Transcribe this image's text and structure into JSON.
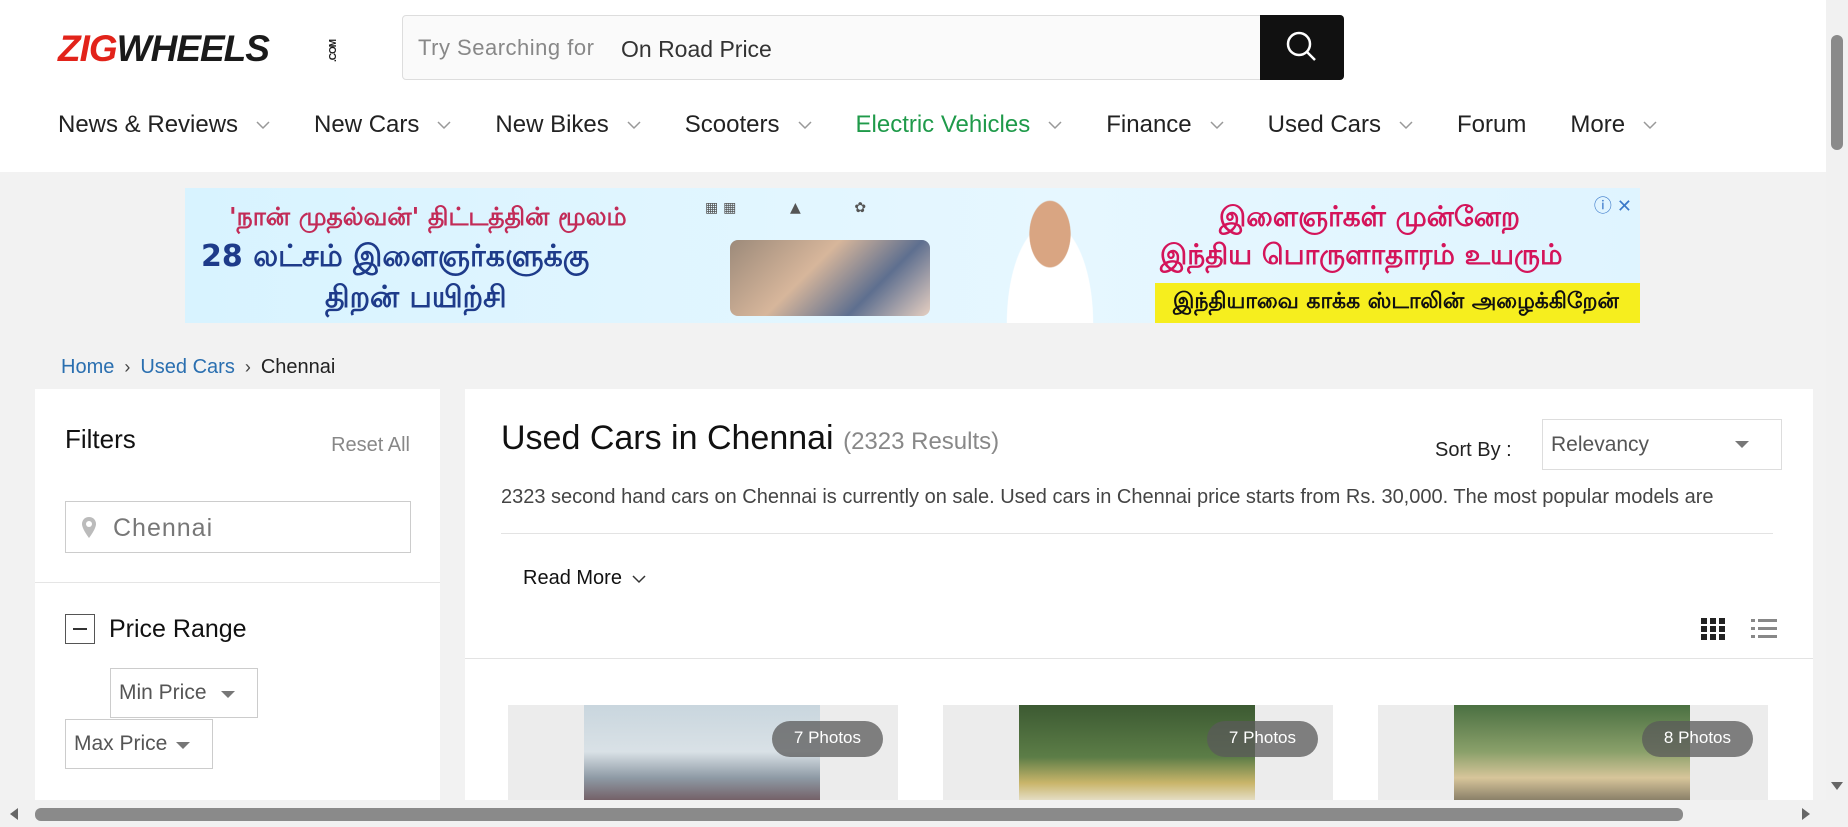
{
  "header": {
    "logo": {
      "part1": "ZIG",
      "part2": "WHEELS",
      "suffix": ".COM"
    },
    "search": {
      "placeholder": "Try Searching for",
      "value": "On Road Price"
    },
    "nav": [
      {
        "label": "News & Reviews",
        "has_menu": true
      },
      {
        "label": "New Cars",
        "has_menu": true
      },
      {
        "label": "New Bikes",
        "has_menu": true
      },
      {
        "label": "Scooters",
        "has_menu": true
      },
      {
        "label": "Electric Vehicles",
        "has_menu": true,
        "highlight": "#1f9a4a"
      },
      {
        "label": "Finance",
        "has_menu": true
      },
      {
        "label": "Used Cars",
        "has_menu": true
      },
      {
        "label": "Forum",
        "has_menu": false
      },
      {
        "label": "More",
        "has_menu": true
      }
    ]
  },
  "ad": {
    "line1": "'நான் முதல்வன்' திட்டத்தின் மூலம்",
    "line2": "28 லட்சம் இளைஞர்களுக்கு",
    "line3": "திறன் பயிற்சி",
    "right1": "இளைஞர்கள் முன்னேற",
    "right2": "இந்திய பொருளாதாரம் உயரும்",
    "right3": "இந்தியாவை காக்க ஸ்டாலின் அழைக்கிறேன்"
  },
  "breadcrumb": {
    "home": "Home",
    "section": "Used Cars",
    "current": "Chennai"
  },
  "filters": {
    "title": "Filters",
    "reset": "Reset All",
    "city": "Chennai",
    "price_range": {
      "label": "Price Range",
      "min": "Min Price",
      "max": "Max Price"
    }
  },
  "main": {
    "title": "Used Cars in Chennai",
    "count": "(2323 Results)",
    "sort_label": "Sort By :",
    "sort_value": "Relevancy",
    "description": "2323 second hand cars on Chennai is currently on sale. Used cars in Chennai price starts from Rs. 30,000. The most popular models are",
    "read_more": "Read More",
    "cards": [
      {
        "photos": "7 Photos"
      },
      {
        "photos": "7 Photos"
      },
      {
        "photos": "8 Photos"
      }
    ]
  },
  "colors": {
    "brand_red": "#e2231a",
    "ev_green": "#1f9a4a",
    "link_blue": "#2a6fb0"
  }
}
